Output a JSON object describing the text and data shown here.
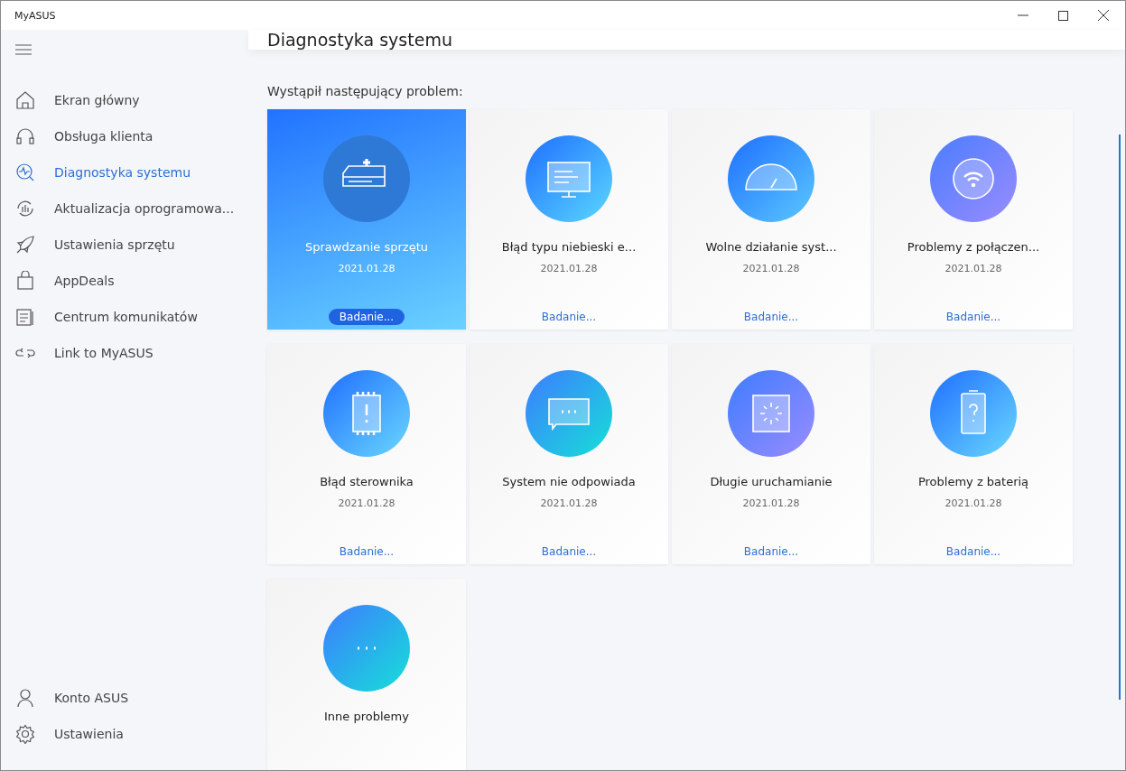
{
  "window": {
    "title": "MyASUS"
  },
  "sidebar": {
    "items": [
      {
        "label": "Ekran główny",
        "selected": false
      },
      {
        "label": "Obsługa klienta",
        "selected": false
      },
      {
        "label": "Diagnostyka systemu",
        "selected": true
      },
      {
        "label": "Aktualizacja oprogramowa...",
        "selected": false
      },
      {
        "label": "Ustawienia sprzętu",
        "selected": false
      },
      {
        "label": "AppDeals",
        "selected": false
      },
      {
        "label": "Centrum komunikatów",
        "selected": false
      },
      {
        "label": "Link to MyASUS",
        "selected": false
      }
    ],
    "bottom_items": [
      {
        "label": "Konto ASUS"
      },
      {
        "label": "Ustawienia"
      }
    ]
  },
  "page": {
    "title": "Diagnostyka systemu",
    "subtitle": "Wystąpił następujący problem:"
  },
  "cards": [
    {
      "title": "Sprawdzanie sprzętu",
      "date": "2021.01.28",
      "action": "Badanie...",
      "selected": true
    },
    {
      "title": "Błąd typu niebieski e...",
      "date": "2021.01.28",
      "action": "Badanie...",
      "selected": false
    },
    {
      "title": "Wolne działanie syst...",
      "date": "2021.01.28",
      "action": "Badanie...",
      "selected": false
    },
    {
      "title": "Problemy z połączen...",
      "date": "2021.01.28",
      "action": "Badanie...",
      "selected": false
    },
    {
      "title": "Błąd sterownika",
      "date": "2021.01.28",
      "action": "Badanie...",
      "selected": false
    },
    {
      "title": "System nie odpowiada",
      "date": "2021.01.28",
      "action": "Badanie...",
      "selected": false
    },
    {
      "title": "Długie uruchamianie",
      "date": "2021.01.28",
      "action": "Badanie...",
      "selected": false
    },
    {
      "title": "Problemy z baterią",
      "date": "2021.01.28",
      "action": "Badanie...",
      "selected": false
    },
    {
      "title": "Inne problemy",
      "selected": false
    }
  ]
}
